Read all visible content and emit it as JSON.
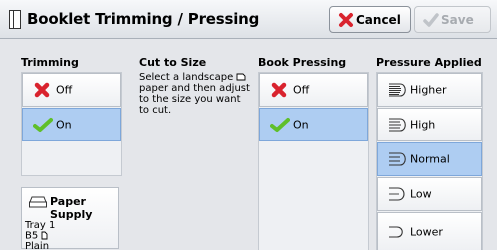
{
  "header": {
    "title": "Booklet Trimming / Pressing",
    "cancel_label": "Cancel",
    "save_label": "Save"
  },
  "trimming": {
    "heading": "Trimming",
    "options": [
      {
        "label": "Off",
        "icon": "red-x-icon",
        "selected": false
      },
      {
        "label": "On",
        "icon": "green-check-icon",
        "selected": true
      }
    ]
  },
  "cut_to_size": {
    "heading": "Cut to Size",
    "line1": "Select a landscape",
    "line2": "paper and then adjust",
    "line3": "to the size you want",
    "line4": "to cut."
  },
  "paper_supply": {
    "label": "Paper Supply",
    "tray": "Tray 1",
    "size": "B5",
    "type": "Plain"
  },
  "book_pressing": {
    "heading": "Book Pressing",
    "options": [
      {
        "label": "Off",
        "icon": "red-x-icon",
        "selected": false
      },
      {
        "label": "On",
        "icon": "green-check-icon",
        "selected": true
      }
    ]
  },
  "pressure": {
    "heading": "Pressure Applied",
    "options": [
      {
        "label": "Higher",
        "selected": false
      },
      {
        "label": "High",
        "selected": false
      },
      {
        "label": "Normal",
        "selected": true
      },
      {
        "label": "Low",
        "selected": false
      },
      {
        "label": "Lower",
        "selected": false
      }
    ]
  },
  "colors": {
    "selected": "#aecdf2",
    "background": "#e4e6ea"
  }
}
